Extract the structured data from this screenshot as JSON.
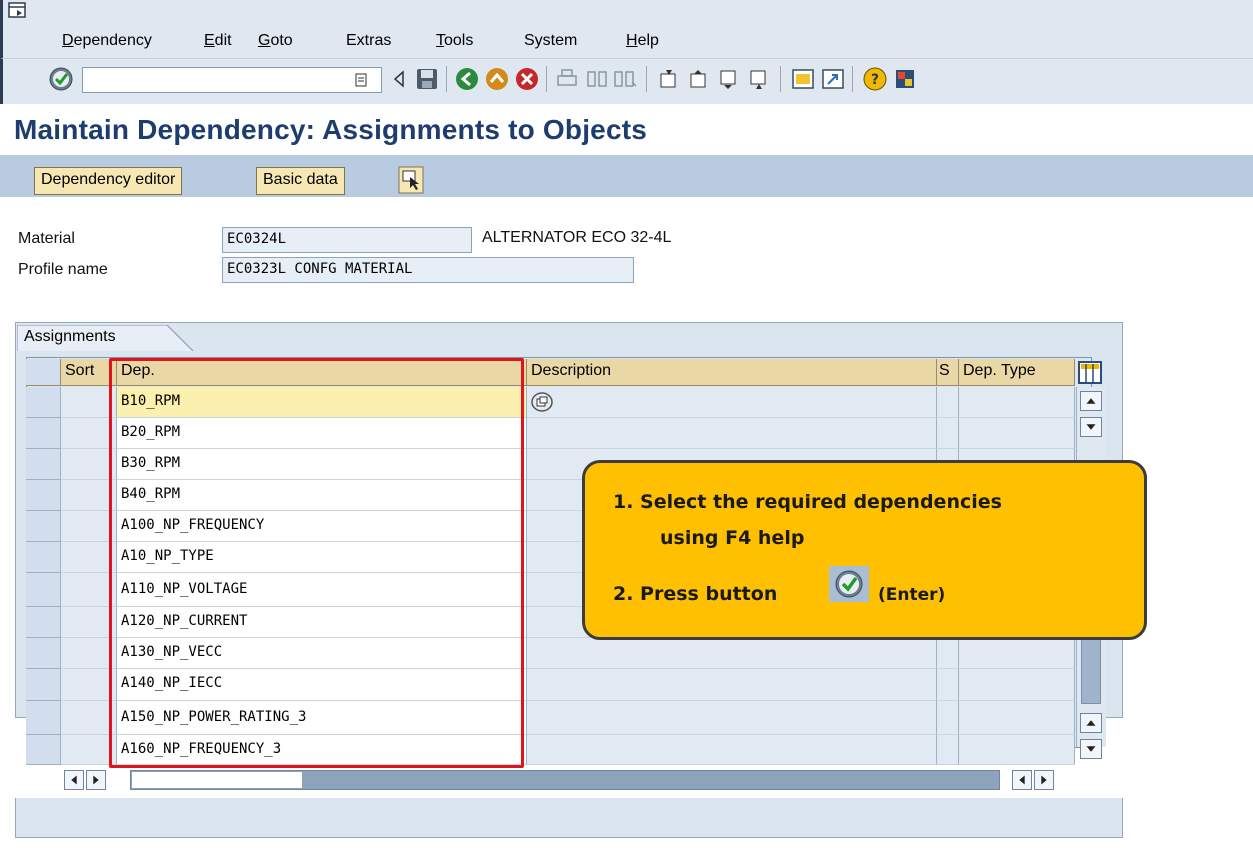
{
  "menu": {
    "items": [
      {
        "underline": "D",
        "rest": "ependency"
      },
      {
        "underline": "E",
        "rest": "dit"
      },
      {
        "underline": "G",
        "rest": "oto"
      },
      {
        "underline": "",
        "rest": "Extras"
      },
      {
        "underline": "T",
        "rest": "ools"
      },
      {
        "underline": "",
        "rest": "System"
      },
      {
        "underline": "H",
        "rest": "elp"
      }
    ]
  },
  "toolbar": {
    "command_value": "",
    "icons": [
      "enter-icon",
      "command-dropdown-icon",
      "back-arrow-icon",
      "save-icon",
      "back-icon",
      "exit-icon",
      "cancel-icon",
      "print-icon",
      "find-icon",
      "find-next-icon",
      "first-page-icon",
      "previous-page-icon",
      "next-page-icon",
      "last-page-icon",
      "create-session-icon",
      "shortcut-icon",
      "help-icon",
      "customize-layout-icon"
    ]
  },
  "title": "Maintain Dependency: Assignments to Objects",
  "app_toolbar": {
    "dependency_editor": "Dependency editor",
    "basic_data": "Basic data"
  },
  "header": {
    "material_label": "Material",
    "material_value": "EC0324L",
    "material_desc": "ALTERNATOR ECO 32-4L",
    "profile_label": "Profile name",
    "profile_value": "EC0323L CONFG MATERIAL"
  },
  "assignments": {
    "tab_label": "Assignments",
    "columns": {
      "sort": "Sort",
      "dep": "Dep.",
      "description": "Description",
      "s": "S",
      "dep_type": "Dep. Type"
    },
    "rows": [
      "B10_RPM",
      "B20_RPM",
      "B30_RPM",
      "B40_RPM",
      "A100_NP_FREQUENCY",
      "A10_NP_TYPE",
      "A110_NP_VOLTAGE",
      "A120_NP_CURRENT",
      "A130_NP_VECC",
      "A140_NP_IECC",
      "A150_NP_POWER_RATING_3",
      "A160_NP_FREQUENCY_3"
    ]
  },
  "callout": {
    "line1": "1. Select the required dependencies",
    "line2": "using F4 help",
    "line3_prefix": "2. Press button",
    "line3_suffix": "(Enter)"
  },
  "colors": {
    "title": "#1d3d6e",
    "callout_bg": "#fec000",
    "highlight": "#e0141e"
  }
}
